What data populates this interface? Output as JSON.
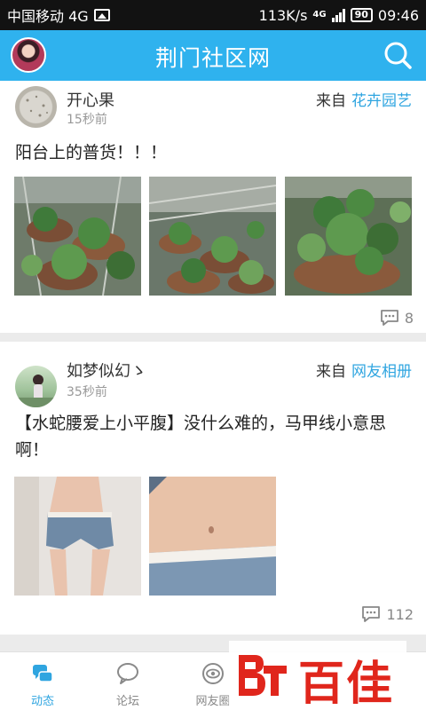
{
  "status_bar": {
    "carrier": "中国移动 4G",
    "speed": "113K/s",
    "network": "4G",
    "battery": "90",
    "time": "09:46",
    "icons": [
      "image-notification-icon",
      "signal-icon",
      "battery-icon"
    ]
  },
  "header": {
    "title": "荆门社区网",
    "icons": [
      "avatar",
      "search-icon"
    ]
  },
  "posts": [
    {
      "author": "开心果",
      "time": "15秒前",
      "source_prefix": "来自",
      "source": "花卉园艺",
      "text": "阳台上的普货！！！",
      "photos": [
        "balcony-plants-photo-1",
        "balcony-plants-photo-2",
        "balcony-plants-photo-3"
      ],
      "comments": "8"
    },
    {
      "author": "如梦似幻ゝ",
      "time": "35秒前",
      "source_prefix": "来自",
      "source": "网友相册",
      "text": "【水蛇腰爱上小平腹】没什么难的，马甲线小意思啊！",
      "photos": [
        "waist-photo-1",
        "waist-photo-2"
      ],
      "comments": "112"
    }
  ],
  "bottom_nav": {
    "tabs": [
      {
        "label": "动态",
        "icon": "feed-icon",
        "active": true
      },
      {
        "label": "论坛",
        "icon": "forum-bubble-icon",
        "active": false
      },
      {
        "label": "网友圈",
        "icon": "circle-eye-icon",
        "active": false
      },
      {
        "label": "",
        "icon": "hidden-tab-icon",
        "active": false
      },
      {
        "label": "",
        "icon": "hidden-tab-icon",
        "active": false
      }
    ]
  },
  "watermark": {
    "text": "百佳"
  },
  "colors": {
    "brand": "#2fb2ee",
    "link": "#2fa5e0",
    "watermark_red": "#e0261c"
  }
}
